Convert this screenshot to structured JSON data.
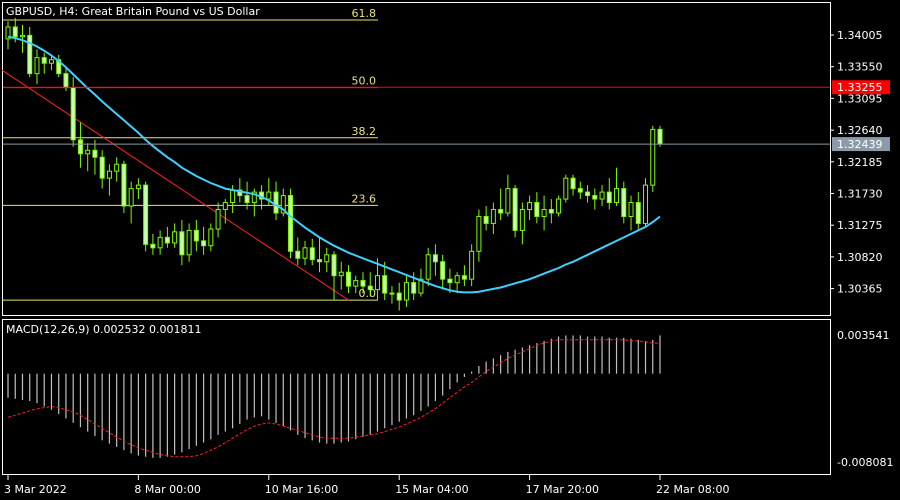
{
  "chart_title": "GBPUSD, H4:  Great Britain Pound vs US Dollar",
  "macd_label": "MACD(12,26,9) 0.002532 0.001811",
  "colors": {
    "background": "#000000",
    "frame": "#ffffff",
    "candle": "#7CFC00",
    "candle_body": "#c8ffb0",
    "ma": "#3fd0ff",
    "trend": "#ff2020",
    "fib": "#e8e27a",
    "fib_50": "#ff3030",
    "macd_hist": "#c0c0c0",
    "macd_signal": "#ff2020",
    "price_tag_red": "#ff0000",
    "price_tag_gray": "#8a9aa8"
  },
  "chart_data": [
    {
      "type": "candlestick",
      "panel": "price",
      "ylim": [
        1.3,
        1.3445
      ],
      "y_ticks": [
        "1.34005",
        "1.33550",
        "1.33095",
        "1.32640",
        "1.32185",
        "1.31730",
        "1.31275",
        "1.30820",
        "1.30365"
      ],
      "x_ticks": [
        "3 Mar 2022",
        "8 Mar 00:00",
        "10 Mar 16:00",
        "15 Mar 04:00",
        "17 Mar 20:00",
        "22 Mar 08:00"
      ],
      "price_tags": [
        {
          "label": "1.33255",
          "value": 1.33255,
          "style": "red"
        },
        {
          "label": "1.32439",
          "value": 1.32439,
          "style": "gray"
        }
      ],
      "fib_levels": [
        {
          "label": "61.8",
          "value": 1.3422
        },
        {
          "label": "50.0",
          "value": 1.3325
        },
        {
          "label": "38.2",
          "value": 1.3253
        },
        {
          "label": "23.6",
          "value": 1.3156
        },
        {
          "label": "0.0",
          "value": 1.302
        }
      ],
      "candles": [
        [
          1.3395,
          1.342,
          1.338,
          1.3412
        ],
        [
          1.3412,
          1.3425,
          1.339,
          1.3398
        ],
        [
          1.3398,
          1.3415,
          1.3375,
          1.34
        ],
        [
          1.34,
          1.3412,
          1.334,
          1.3345
        ],
        [
          1.3345,
          1.338,
          1.333,
          1.3368
        ],
        [
          1.3368,
          1.3375,
          1.3345,
          1.336
        ],
        [
          1.336,
          1.337,
          1.335,
          1.3365
        ],
        [
          1.3365,
          1.3372,
          1.334,
          1.3345
        ],
        [
          1.3345,
          1.3355,
          1.332,
          1.3325
        ],
        [
          1.3325,
          1.334,
          1.324,
          1.325
        ],
        [
          1.325,
          1.3275,
          1.321,
          1.323
        ],
        [
          1.323,
          1.3245,
          1.3205,
          1.3235
        ],
        [
          1.3235,
          1.325,
          1.32,
          1.3225
        ],
        [
          1.3225,
          1.3235,
          1.318,
          1.3195
        ],
        [
          1.3195,
          1.3215,
          1.317,
          1.3205
        ],
        [
          1.3205,
          1.3225,
          1.319,
          1.3215
        ],
        [
          1.3215,
          1.322,
          1.3145,
          1.3155
        ],
        [
          1.3155,
          1.319,
          1.313,
          1.318
        ],
        [
          1.318,
          1.3195,
          1.3165,
          1.3185
        ],
        [
          1.3185,
          1.319,
          1.309,
          1.31
        ],
        [
          1.31,
          1.3115,
          1.3085,
          1.3095
        ],
        [
          1.3095,
          1.312,
          1.3085,
          1.311
        ],
        [
          1.311,
          1.3125,
          1.3095,
          1.3102
        ],
        [
          1.3102,
          1.313,
          1.3095,
          1.3118
        ],
        [
          1.3118,
          1.3135,
          1.307,
          1.3085
        ],
        [
          1.3085,
          1.313,
          1.3075,
          1.312
        ],
        [
          1.312,
          1.3135,
          1.309,
          1.3105
        ],
        [
          1.3105,
          1.3125,
          1.3085,
          1.3098
        ],
        [
          1.3098,
          1.313,
          1.309,
          1.3122
        ],
        [
          1.3122,
          1.316,
          1.311,
          1.315
        ],
        [
          1.315,
          1.3165,
          1.313,
          1.316
        ],
        [
          1.316,
          1.3185,
          1.3145,
          1.3178
        ],
        [
          1.3178,
          1.3195,
          1.316,
          1.317
        ],
        [
          1.317,
          1.319,
          1.315,
          1.316
        ],
        [
          1.316,
          1.318,
          1.314,
          1.3175
        ],
        [
          1.3175,
          1.3185,
          1.315,
          1.3165
        ],
        [
          1.3165,
          1.3195,
          1.3155,
          1.3175
        ],
        [
          1.3175,
          1.319,
          1.3135,
          1.3145
        ],
        [
          1.3145,
          1.318,
          1.314,
          1.317
        ],
        [
          1.317,
          1.318,
          1.308,
          1.309
        ],
        [
          1.309,
          1.311,
          1.307,
          1.308
        ],
        [
          1.308,
          1.3105,
          1.307,
          1.3095
        ],
        [
          1.3095,
          1.3108,
          1.307,
          1.3078
        ],
        [
          1.3078,
          1.311,
          1.306,
          1.3075
        ],
        [
          1.3075,
          1.3095,
          1.306,
          1.3085
        ],
        [
          1.3085,
          1.309,
          1.302,
          1.3055
        ],
        [
          1.3055,
          1.3075,
          1.3035,
          1.306
        ],
        [
          1.306,
          1.307,
          1.303,
          1.304
        ],
        [
          1.304,
          1.3055,
          1.303,
          1.3048
        ],
        [
          1.3048,
          1.306,
          1.303,
          1.304
        ],
        [
          1.304,
          1.306,
          1.3025,
          1.3035
        ],
        [
          1.3035,
          1.308,
          1.302,
          1.3055
        ],
        [
          1.3055,
          1.3075,
          1.302,
          1.303
        ],
        [
          1.303,
          1.304,
          1.3015,
          1.303
        ],
        [
          1.303,
          1.3045,
          1.3005,
          1.302
        ],
        [
          1.302,
          1.3055,
          1.301,
          1.3045
        ],
        [
          1.3045,
          1.306,
          1.302,
          1.303
        ],
        [
          1.303,
          1.3065,
          1.3025,
          1.305
        ],
        [
          1.305,
          1.3095,
          1.304,
          1.3085
        ],
        [
          1.3085,
          1.31,
          1.3055,
          1.3075
        ],
        [
          1.3075,
          1.3085,
          1.3035,
          1.305
        ],
        [
          1.305,
          1.3065,
          1.303,
          1.3045
        ],
        [
          1.3045,
          1.306,
          1.303,
          1.3055
        ],
        [
          1.3055,
          1.307,
          1.304,
          1.305
        ],
        [
          1.305,
          1.31,
          1.304,
          1.309
        ],
        [
          1.309,
          1.315,
          1.3075,
          1.314
        ],
        [
          1.314,
          1.3155,
          1.312,
          1.313
        ],
        [
          1.313,
          1.316,
          1.3115,
          1.315
        ],
        [
          1.315,
          1.318,
          1.3135,
          1.3145
        ],
        [
          1.3145,
          1.32,
          1.314,
          1.318
        ],
        [
          1.318,
          1.3185,
          1.311,
          1.312
        ],
        [
          1.312,
          1.316,
          1.31,
          1.315
        ],
        [
          1.315,
          1.317,
          1.3135,
          1.316
        ],
        [
          1.316,
          1.3175,
          1.313,
          1.314
        ],
        [
          1.314,
          1.317,
          1.312,
          1.315
        ],
        [
          1.315,
          1.3165,
          1.313,
          1.3145
        ],
        [
          1.3145,
          1.317,
          1.314,
          1.3165
        ],
        [
          1.3165,
          1.32,
          1.316,
          1.3195
        ],
        [
          1.3195,
          1.32,
          1.317,
          1.318
        ],
        [
          1.318,
          1.319,
          1.3165,
          1.3175
        ],
        [
          1.3175,
          1.3185,
          1.316,
          1.317
        ],
        [
          1.317,
          1.318,
          1.315,
          1.3165
        ],
        [
          1.3165,
          1.3185,
          1.3155,
          1.3175
        ],
        [
          1.3175,
          1.3195,
          1.315,
          1.316
        ],
        [
          1.316,
          1.321,
          1.3155,
          1.318
        ],
        [
          1.318,
          1.319,
          1.313,
          1.314
        ],
        [
          1.314,
          1.317,
          1.312,
          1.316
        ],
        [
          1.316,
          1.3175,
          1.312,
          1.313
        ],
        [
          1.313,
          1.3195,
          1.3125,
          1.3185
        ],
        [
          1.3185,
          1.327,
          1.3175,
          1.3265
        ],
        [
          1.3265,
          1.327,
          1.324,
          1.3244
        ]
      ],
      "ma": [
        1.3398,
        1.3396,
        1.3393,
        1.3389,
        1.3384,
        1.3378,
        1.3371,
        1.3363,
        1.3354,
        1.3344,
        1.3334,
        1.3324,
        1.3315,
        1.3305,
        1.3296,
        1.3287,
        1.3278,
        1.3269,
        1.326,
        1.325,
        1.3241,
        1.3233,
        1.3225,
        1.3218,
        1.321,
        1.3204,
        1.3198,
        1.3193,
        1.3188,
        1.3184,
        1.318,
        1.3178,
        1.3176,
        1.3174,
        1.3172,
        1.3168,
        1.3163,
        1.3156,
        1.315,
        1.314,
        1.3132,
        1.3124,
        1.3117,
        1.311,
        1.3104,
        1.3098,
        1.3093,
        1.3088,
        1.3084,
        1.308,
        1.3076,
        1.3072,
        1.3068,
        1.3064,
        1.306,
        1.3056,
        1.3052,
        1.3048,
        1.3044,
        1.304,
        1.3037,
        1.3034,
        1.3032,
        1.3031,
        1.3031,
        1.3032,
        1.3034,
        1.3036,
        1.3038,
        1.3041,
        1.3044,
        1.3047,
        1.305,
        1.3054,
        1.3058,
        1.3062,
        1.3066,
        1.3071,
        1.3075,
        1.308,
        1.3085,
        1.309,
        1.3095,
        1.31,
        1.3105,
        1.311,
        1.3115,
        1.312,
        1.3125,
        1.3132,
        1.314
      ],
      "trendline": {
        "start": [
          0,
          1.335
        ],
        "end": [
          47,
          1.302
        ]
      }
    },
    {
      "type": "macd",
      "panel": "indicator",
      "ylim": [
        -0.008081,
        0.003541
      ],
      "y_ticks": [
        "0.003541",
        "-0.008081"
      ],
      "hist": [
        -0.0022,
        -0.0023,
        -0.0024,
        -0.0025,
        -0.0027,
        -0.003,
        -0.0033,
        -0.0037,
        -0.0041,
        -0.0045,
        -0.0049,
        -0.0053,
        -0.0057,
        -0.0061,
        -0.0064,
        -0.0067,
        -0.007,
        -0.0073,
        -0.0075,
        -0.0076,
        -0.0077,
        -0.0077,
        -0.0076,
        -0.0074,
        -0.0072,
        -0.0069,
        -0.0066,
        -0.0063,
        -0.006,
        -0.0056,
        -0.0053,
        -0.005,
        -0.0046,
        -0.0042,
        -0.004,
        -0.0039,
        -0.0042,
        -0.0045,
        -0.0048,
        -0.0052,
        -0.0056,
        -0.0059,
        -0.0061,
        -0.0063,
        -0.0064,
        -0.0064,
        -0.0063,
        -0.0062,
        -0.006,
        -0.0058,
        -0.0056,
        -0.0053,
        -0.005,
        -0.0047,
        -0.0044,
        -0.0041,
        -0.0038,
        -0.0034,
        -0.003,
        -0.0025,
        -0.002,
        -0.0014,
        -0.0008,
        -0.0003,
        0.0002,
        0.0007,
        0.0011,
        0.0014,
        0.0017,
        0.002,
        0.0022,
        0.0024,
        0.0026,
        0.0028,
        0.003,
        0.0032,
        0.0034,
        0.0035,
        0.0035,
        0.0035,
        0.0034,
        0.0034,
        0.0034,
        0.0033,
        0.0033,
        0.0033,
        0.0032,
        0.0031,
        0.003,
        0.0031,
        0.0035
      ],
      "signal": [
        -0.004,
        -0.0038,
        -0.0036,
        -0.0034,
        -0.0032,
        -0.0031,
        -0.003,
        -0.0031,
        -0.0033,
        -0.0035,
        -0.0038,
        -0.0042,
        -0.0046,
        -0.005,
        -0.0054,
        -0.0058,
        -0.0062,
        -0.0065,
        -0.0068,
        -0.007,
        -0.0072,
        -0.0074,
        -0.0075,
        -0.0076,
        -0.0076,
        -0.0076,
        -0.0075,
        -0.0073,
        -0.007,
        -0.0067,
        -0.0063,
        -0.0059,
        -0.0055,
        -0.0051,
        -0.0048,
        -0.0046,
        -0.0045,
        -0.0046,
        -0.0048,
        -0.005,
        -0.0052,
        -0.0054,
        -0.0056,
        -0.0058,
        -0.0059,
        -0.0059,
        -0.0059,
        -0.0059,
        -0.0058,
        -0.0057,
        -0.0056,
        -0.0055,
        -0.0053,
        -0.0051,
        -0.0049,
        -0.0046,
        -0.0043,
        -0.004,
        -0.0036,
        -0.0032,
        -0.0027,
        -0.0022,
        -0.0017,
        -0.0012,
        -0.0008,
        -0.0003,
        0.0002,
        0.0006,
        0.001,
        0.0014,
        0.0017,
        0.002,
        0.0023,
        0.0026,
        0.0028,
        0.003,
        0.0031,
        0.0031,
        0.0031,
        0.0031,
        0.0031,
        0.0031,
        0.0031,
        0.0031,
        0.0031,
        0.0031,
        0.003,
        0.003,
        0.0029,
        0.0028,
        0.0028
      ]
    }
  ]
}
